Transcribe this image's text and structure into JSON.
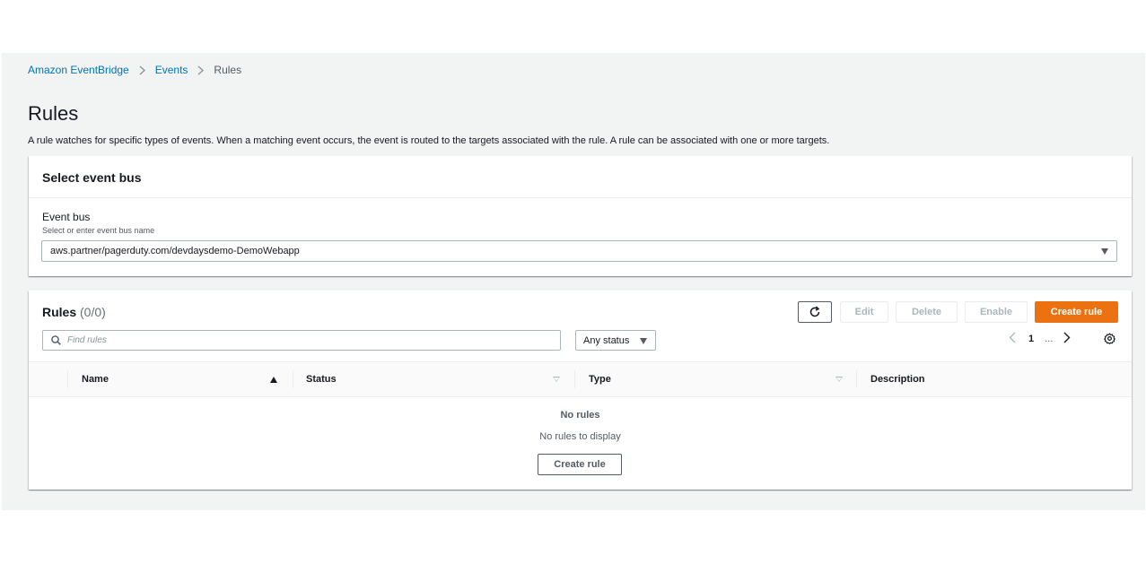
{
  "breadcrumb": {
    "root": "Amazon EventBridge",
    "section": "Events",
    "current": "Rules"
  },
  "page": {
    "title": "Rules",
    "description": "A rule watches for specific types of events. When a matching event occurs, the event is routed to the targets associated with the rule. A rule can be associated with one or more targets."
  },
  "event_bus_panel": {
    "header": "Select event bus",
    "label": "Event bus",
    "sublabel": "Select or enter event bus name",
    "value": "aws.partner/pagerduty.com/devdaysdemo-DemoWebapp"
  },
  "rules_panel": {
    "title": "Rules",
    "count": "(0/0)",
    "buttons": {
      "edit": "Edit",
      "delete": "Delete",
      "enable": "Enable",
      "create": "Create rule"
    },
    "search_placeholder": "Find rules",
    "status_filter": "Any status",
    "page_number": "1",
    "page_dots": "...",
    "columns": [
      "Name",
      "Status",
      "Type",
      "Description"
    ],
    "empty_title": "No rules",
    "empty_subtitle": "No rules to display",
    "empty_button": "Create rule"
  },
  "colors": {
    "link": "#0073bb",
    "primary": "#ec7211",
    "background": "#f2f3f3"
  },
  "icons": [
    "chevron-right-icon",
    "refresh-icon",
    "search-icon",
    "caret-down-icon",
    "chevron-left-icon",
    "gear-icon",
    "sort-asc-icon",
    "sort-desc-icon"
  ]
}
